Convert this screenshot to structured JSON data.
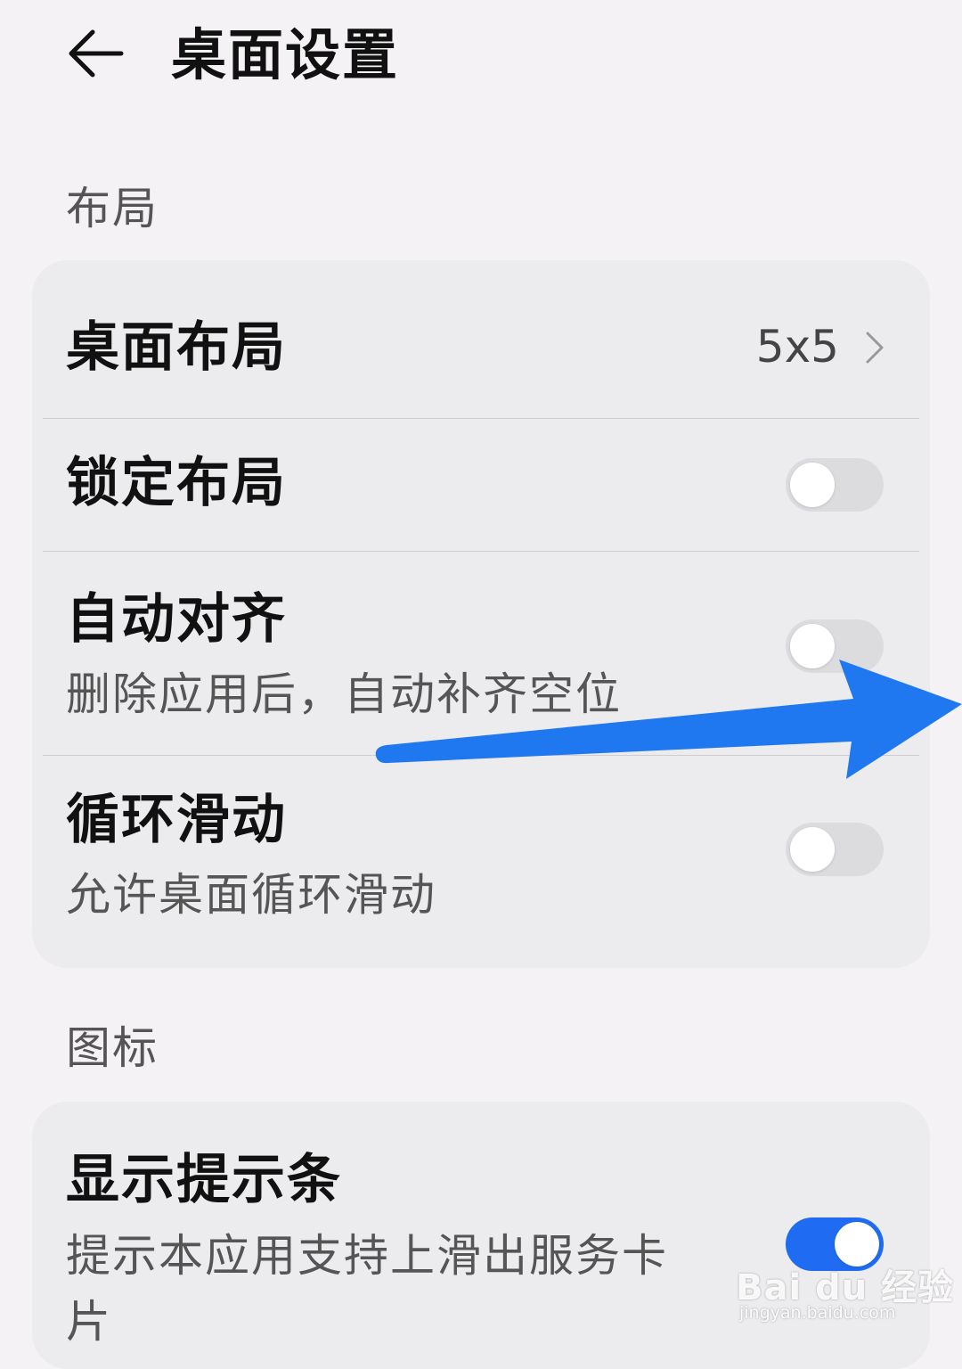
{
  "header": {
    "title": "桌面设置",
    "back_icon": "arrow-left-icon"
  },
  "sections": [
    {
      "label": "布局",
      "items": [
        {
          "title": "桌面布局",
          "value": "5x5",
          "icon": "chevron-right-icon"
        },
        {
          "title": "锁定布局",
          "toggle_on": false
        },
        {
          "title": "自动对齐",
          "subtitle": "删除应用后，自动补齐空位",
          "toggle_on": false
        },
        {
          "title": "循环滑动",
          "subtitle": "允许桌面循环滑动",
          "toggle_on": false
        }
      ]
    },
    {
      "label": "图标",
      "items": [
        {
          "title": "显示提示条",
          "subtitle": "提示本应用支持上滑出服务卡片",
          "toggle_on": true
        }
      ]
    }
  ],
  "overlay": {
    "annotation_arrow_color": "#1f78f0"
  },
  "watermark": {
    "brand": "Bai du 经验",
    "url": "jingyan.baidu.com"
  },
  "colors": {
    "background": "#f4f2f5",
    "card": "#ecebee",
    "toggle_on": "#1f6cf2",
    "toggle_off": "#dcdbde"
  }
}
